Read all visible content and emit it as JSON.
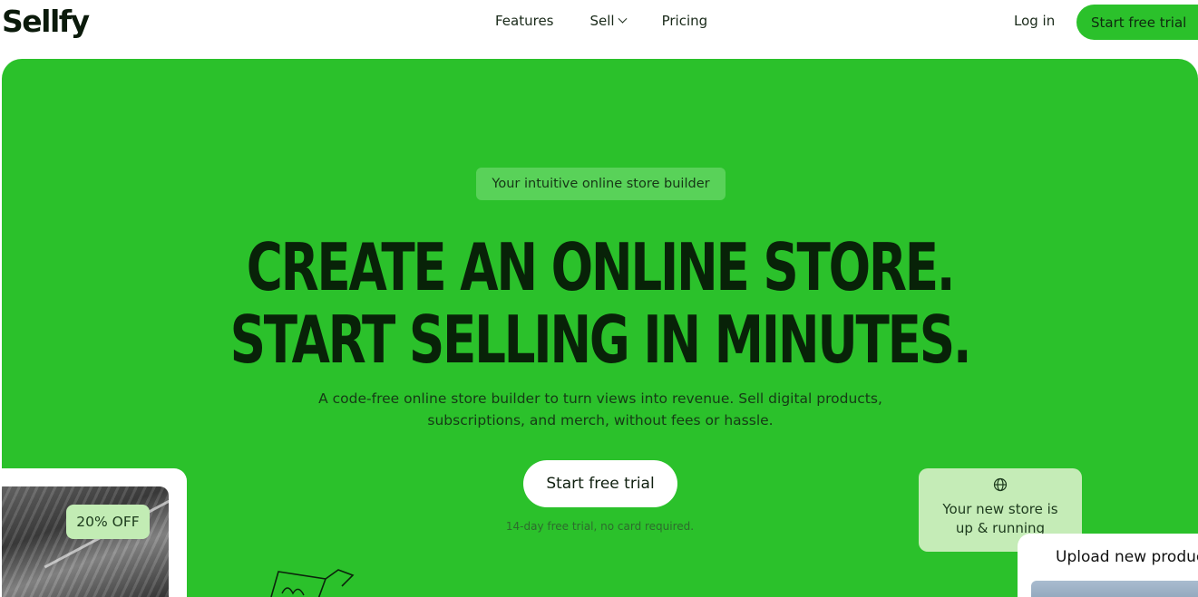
{
  "nav": {
    "logo": "Sellfy",
    "links": [
      {
        "label": "Features",
        "has_dropdown": false
      },
      {
        "label": "Sell",
        "has_dropdown": true
      },
      {
        "label": "Pricing",
        "has_dropdown": false
      }
    ],
    "login_label": "Log in",
    "cta_label": "Start free trial"
  },
  "hero": {
    "pill": "Your intuitive online store builder",
    "headline_line1": "CREATE AN ONLINE STORE.",
    "headline_line2": "START SELLING IN MINUTES.",
    "subtitle": "A code-free online store builder to turn views into revenue. Sell digital products, subscriptions, and merch, without fees or hassle.",
    "cta_label": "Start free trial",
    "note": "14-day free trial, no card required."
  },
  "product_card": {
    "discount_badge": "20% OFF"
  },
  "toast": {
    "icon": "globe-icon",
    "text": "Your new store is up & running"
  },
  "upload_card": {
    "title": "Upload new product"
  },
  "colors": {
    "brand_green": "#2bc12b",
    "badge_green": "#c2ecb4",
    "headline": "#082208"
  }
}
